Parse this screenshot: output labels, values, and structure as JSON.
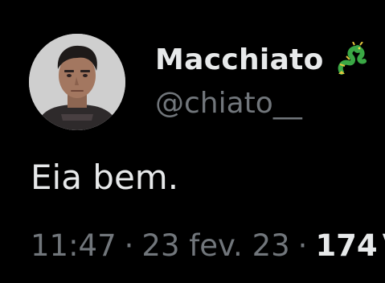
{
  "author": {
    "display_name": "Macchiato",
    "name_emoji": "dragon-emoji",
    "handle": "@chiato__"
  },
  "tweet": {
    "text": "Eia bem."
  },
  "meta": {
    "time": "11:47",
    "separator": "·",
    "date": "23 fev. 23",
    "views_count": "174",
    "views_label": "V"
  },
  "colors": {
    "background": "#000000",
    "primary_text": "#e7e9ea",
    "secondary_text": "#71767b"
  }
}
